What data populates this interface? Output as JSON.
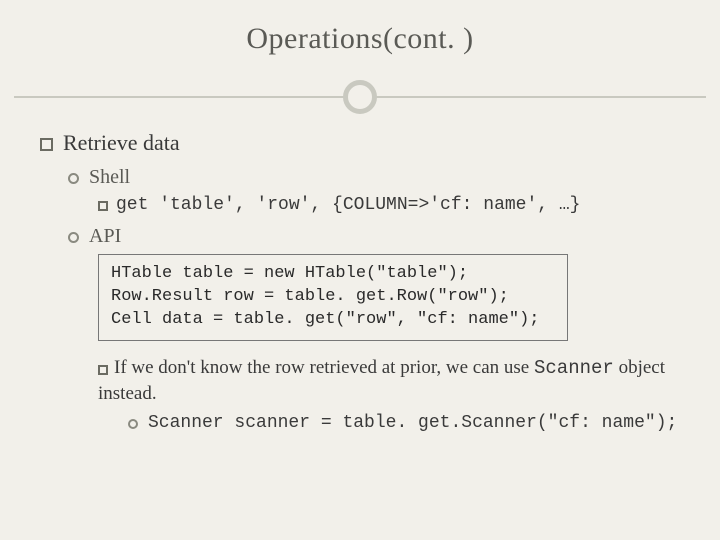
{
  "title": "Operations(cont. )",
  "section": {
    "heading": "Retrieve data"
  },
  "shell": {
    "label": "Shell",
    "command_prefix": "get",
    "command_rest": " 'table', 'row', {COLUMN=>'cf: name', …}"
  },
  "api": {
    "label": "API",
    "code": "HTable table = new HTable(\"table\");\nRow.Result row = table. get.Row(\"row\");\nCell data = table. get(\"row\", \"cf: name\");"
  },
  "note": {
    "text_before": "If we don't know the row retrieved at prior, we can use ",
    "code_word": "Scanner",
    "text_after": " object instead."
  },
  "scanner": {
    "prefix": "Scanner",
    "rest": " scanner = table. get.Scanner(\"cf: name\");"
  }
}
